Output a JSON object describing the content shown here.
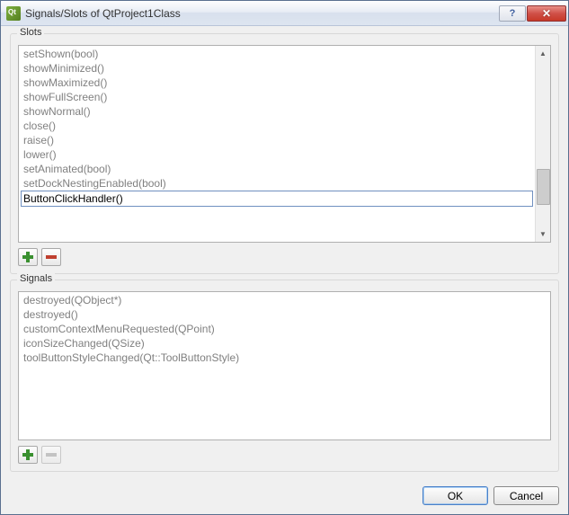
{
  "window": {
    "title": "Signals/Slots of QtProject1Class"
  },
  "slots": {
    "label": "Slots",
    "items": [
      "setShown(bool)",
      "showMinimized()",
      "showMaximized()",
      "showFullScreen()",
      "showNormal()",
      "close()",
      "raise()",
      "lower()",
      "setAnimated(bool)",
      "setDockNestingEnabled(bool)"
    ],
    "edit_value": "ButtonClickHandler()"
  },
  "signals": {
    "label": "Signals",
    "items": [
      "destroyed(QObject*)",
      "destroyed()",
      "customContextMenuRequested(QPoint)",
      "iconSizeChanged(QSize)",
      "toolButtonStyleChanged(Qt::ToolButtonStyle)"
    ]
  },
  "buttons": {
    "ok": "OK",
    "cancel": "Cancel"
  }
}
